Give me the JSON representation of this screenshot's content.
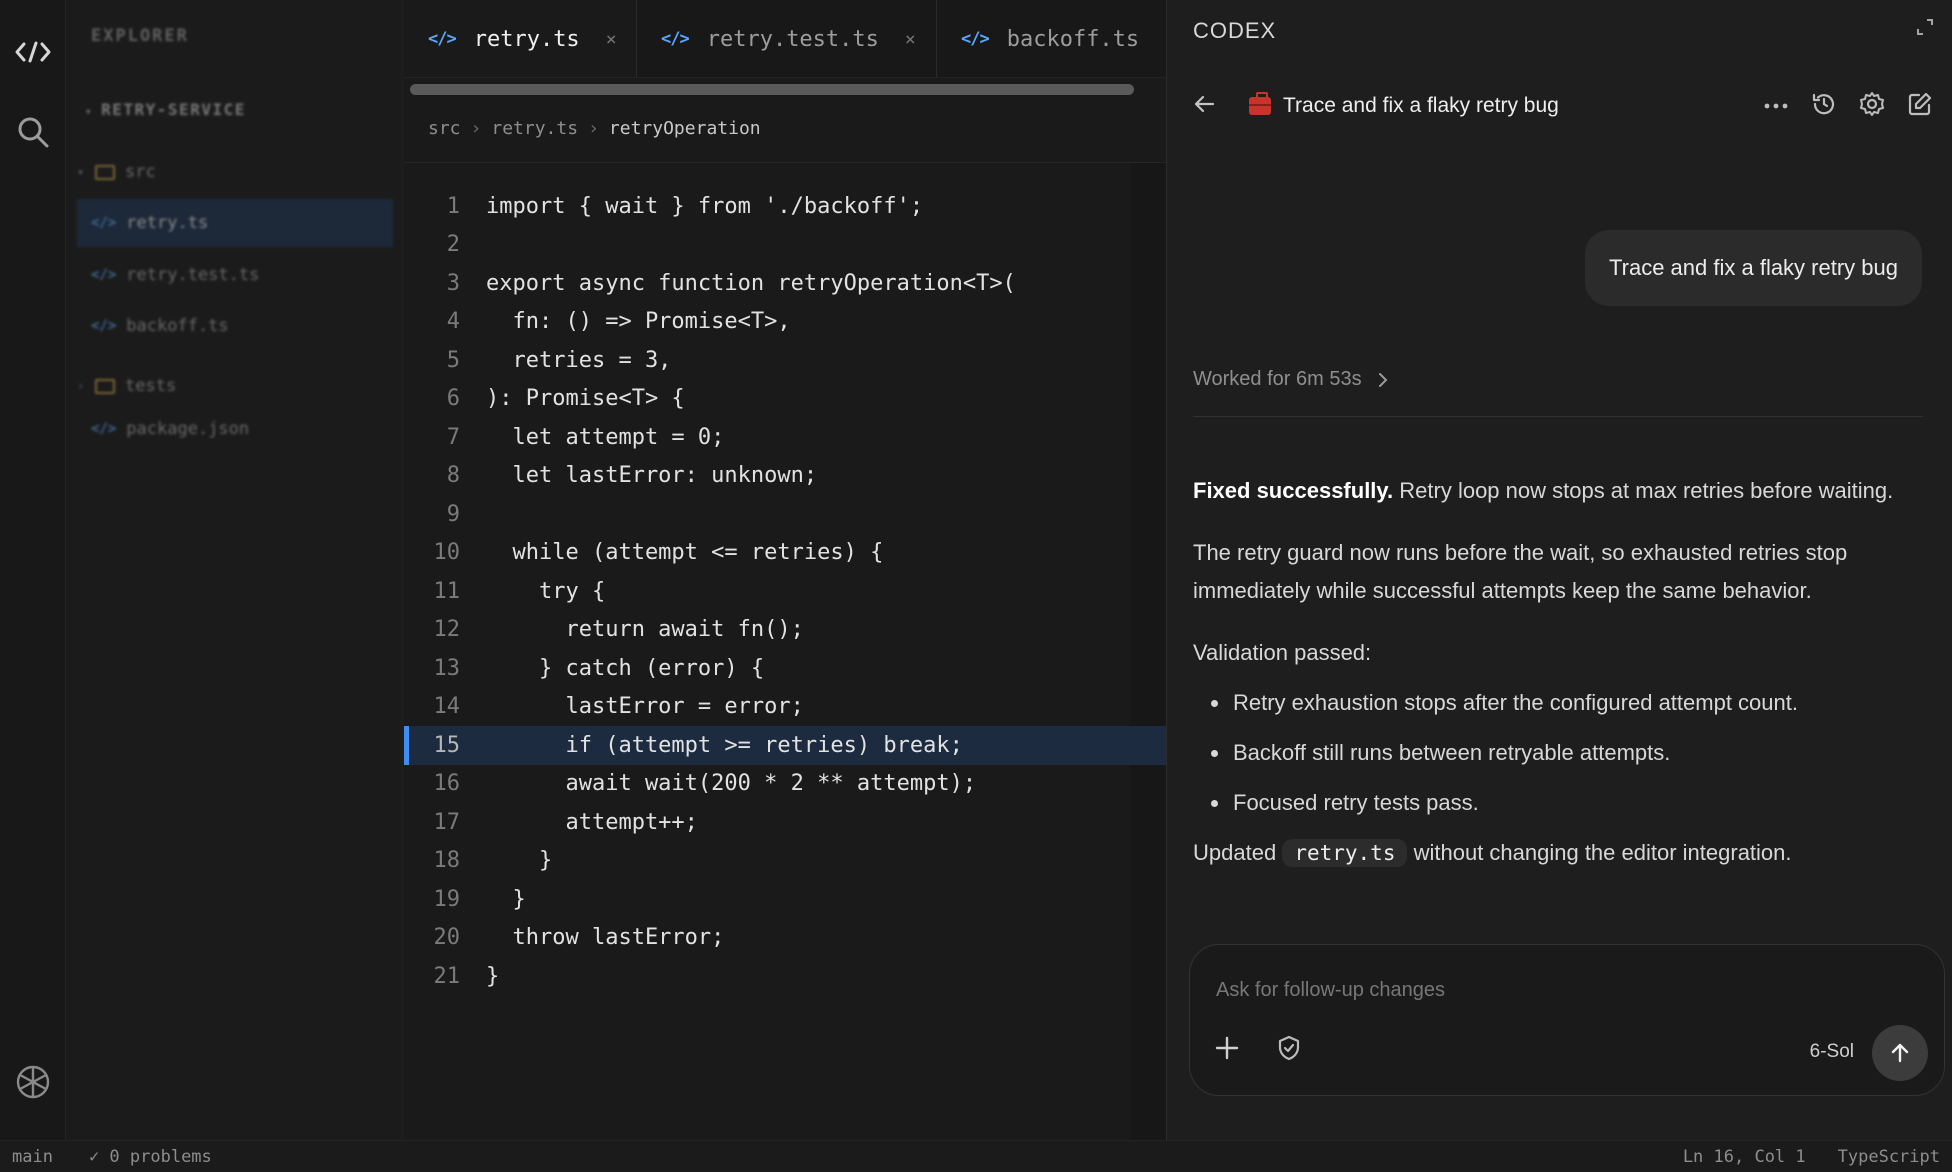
{
  "activity_bar": {
    "icons": [
      "code-logo-icon",
      "search-icon",
      "openai-logo-icon"
    ]
  },
  "explorer": {
    "title": "EXPLORER",
    "project": "RETRY-SERVICE",
    "items": [
      {
        "label": "src",
        "kind": "folder"
      },
      {
        "label": "retry.ts",
        "kind": "file",
        "active": true
      },
      {
        "label": "retry.test.ts",
        "kind": "file"
      },
      {
        "label": "backoff.ts",
        "kind": "file"
      },
      {
        "label": "tests",
        "kind": "folder"
      },
      {
        "label": "package.json",
        "kind": "file"
      }
    ]
  },
  "editor": {
    "tabs": [
      {
        "label": "retry.ts",
        "active": true
      },
      {
        "label": "retry.test.ts"
      },
      {
        "label": "backoff.ts"
      }
    ],
    "breadcrumb": [
      "src",
      "retry.ts",
      "retryOperation"
    ],
    "highlighted_line": 15,
    "lines": [
      "import { wait } from './backoff';",
      "",
      "export async function retryOperation<T>(",
      "  fn: () => Promise<T>,",
      "  retries = 3,",
      "): Promise<T> {",
      "  let attempt = 0;",
      "  let lastError: unknown;",
      "",
      "  while (attempt <= retries) {",
      "    try {",
      "      return await fn();",
      "    } catch (error) {",
      "      lastError = error;",
      "      if (attempt >= retries) break;",
      "      await wait(200 * 2 ** attempt);",
      "      attempt++;",
      "    }",
      "  }",
      "  throw lastError;",
      "}"
    ]
  },
  "codex": {
    "title": "CODEX",
    "task_title": "Trace and fix a flaky retry bug",
    "user_message": "Trace and fix a flaky retry bug",
    "worked": "Worked for 6m 53s",
    "summary_bold": "Fixed successfully.",
    "summary_rest": "Retry loop now stops at max retries before waiting.",
    "paragraph": "The retry guard now runs before the wait, so exhausted retries stop immediately while successful attempts keep the same behavior.",
    "validation_heading": "Validation passed:",
    "validation_items": [
      "Retry exhaustion stops after the configured attempt count.",
      "Backoff still runs between retryable attempts.",
      "Focused retry tests pass."
    ],
    "updated_prefix": "Updated",
    "updated_file": "retry.ts",
    "updated_suffix": "without changing the editor integration.",
    "composer_placeholder": "Ask for follow-up changes",
    "model": "6-Sol"
  },
  "status_bar": {
    "branch": "main",
    "problems": "✓ 0 problems",
    "position": "Ln 16, Col 1",
    "language": "TypeScript"
  },
  "colors": {
    "accent": "#3d8ef0",
    "highlight_line": "#1c2b40",
    "file_icon": "#5aa9ff"
  }
}
